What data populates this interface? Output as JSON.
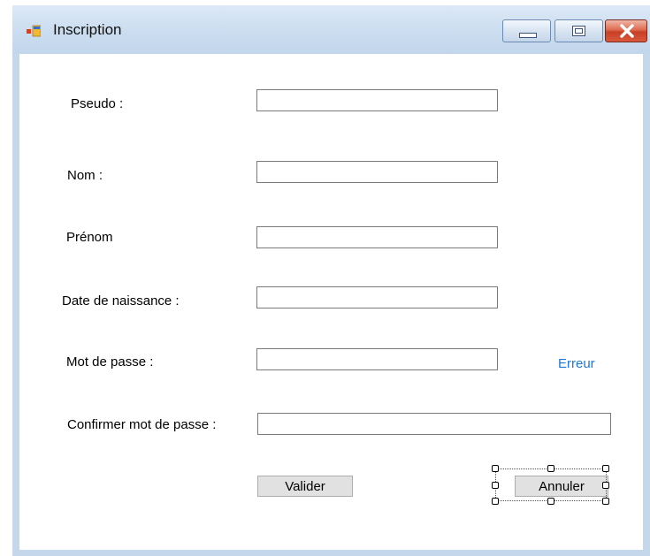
{
  "window": {
    "title": "Inscription",
    "controls": {
      "minimize": "minimize",
      "maximize": "maximize",
      "close": "close"
    }
  },
  "form": {
    "pseudo_label": "Pseudo :",
    "nom_label": "Nom :",
    "prenom_label": "Prénom",
    "naissance_label": "Date de naissance :",
    "mdp_label": "Mot de passe :",
    "confirm_label": "Confirmer mot de passe :",
    "error_text": "Erreur",
    "pseudo_value": "",
    "nom_value": "",
    "prenom_value": "",
    "naissance_value": "",
    "mdp_value": "",
    "confirm_value": ""
  },
  "actions": {
    "valider_label": "Valider",
    "annuler_label": "Annuler"
  },
  "colors": {
    "error": "#1f78d6",
    "titlebar": "#c5d7ea"
  }
}
